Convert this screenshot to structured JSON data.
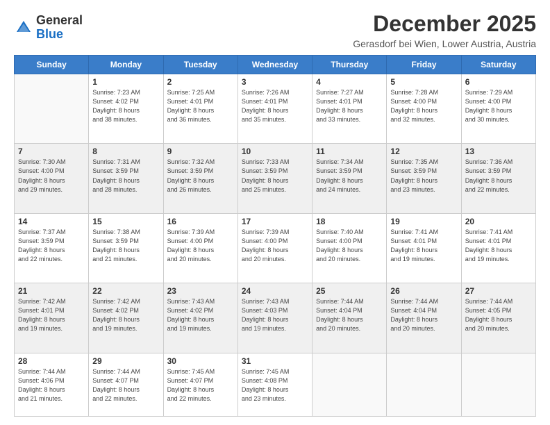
{
  "logo": {
    "general": "General",
    "blue": "Blue"
  },
  "title": "December 2025",
  "location": "Gerasdorf bei Wien, Lower Austria, Austria",
  "weekdays": [
    "Sunday",
    "Monday",
    "Tuesday",
    "Wednesday",
    "Thursday",
    "Friday",
    "Saturday"
  ],
  "weeks": [
    [
      {
        "day": "",
        "info": ""
      },
      {
        "day": "1",
        "info": "Sunrise: 7:23 AM\nSunset: 4:02 PM\nDaylight: 8 hours\nand 38 minutes."
      },
      {
        "day": "2",
        "info": "Sunrise: 7:25 AM\nSunset: 4:01 PM\nDaylight: 8 hours\nand 36 minutes."
      },
      {
        "day": "3",
        "info": "Sunrise: 7:26 AM\nSunset: 4:01 PM\nDaylight: 8 hours\nand 35 minutes."
      },
      {
        "day": "4",
        "info": "Sunrise: 7:27 AM\nSunset: 4:01 PM\nDaylight: 8 hours\nand 33 minutes."
      },
      {
        "day": "5",
        "info": "Sunrise: 7:28 AM\nSunset: 4:00 PM\nDaylight: 8 hours\nand 32 minutes."
      },
      {
        "day": "6",
        "info": "Sunrise: 7:29 AM\nSunset: 4:00 PM\nDaylight: 8 hours\nand 30 minutes."
      }
    ],
    [
      {
        "day": "7",
        "info": "Sunrise: 7:30 AM\nSunset: 4:00 PM\nDaylight: 8 hours\nand 29 minutes."
      },
      {
        "day": "8",
        "info": "Sunrise: 7:31 AM\nSunset: 3:59 PM\nDaylight: 8 hours\nand 28 minutes."
      },
      {
        "day": "9",
        "info": "Sunrise: 7:32 AM\nSunset: 3:59 PM\nDaylight: 8 hours\nand 26 minutes."
      },
      {
        "day": "10",
        "info": "Sunrise: 7:33 AM\nSunset: 3:59 PM\nDaylight: 8 hours\nand 25 minutes."
      },
      {
        "day": "11",
        "info": "Sunrise: 7:34 AM\nSunset: 3:59 PM\nDaylight: 8 hours\nand 24 minutes."
      },
      {
        "day": "12",
        "info": "Sunrise: 7:35 AM\nSunset: 3:59 PM\nDaylight: 8 hours\nand 23 minutes."
      },
      {
        "day": "13",
        "info": "Sunrise: 7:36 AM\nSunset: 3:59 PM\nDaylight: 8 hours\nand 22 minutes."
      }
    ],
    [
      {
        "day": "14",
        "info": "Sunrise: 7:37 AM\nSunset: 3:59 PM\nDaylight: 8 hours\nand 22 minutes."
      },
      {
        "day": "15",
        "info": "Sunrise: 7:38 AM\nSunset: 3:59 PM\nDaylight: 8 hours\nand 21 minutes."
      },
      {
        "day": "16",
        "info": "Sunrise: 7:39 AM\nSunset: 4:00 PM\nDaylight: 8 hours\nand 20 minutes."
      },
      {
        "day": "17",
        "info": "Sunrise: 7:39 AM\nSunset: 4:00 PM\nDaylight: 8 hours\nand 20 minutes."
      },
      {
        "day": "18",
        "info": "Sunrise: 7:40 AM\nSunset: 4:00 PM\nDaylight: 8 hours\nand 20 minutes."
      },
      {
        "day": "19",
        "info": "Sunrise: 7:41 AM\nSunset: 4:01 PM\nDaylight: 8 hours\nand 19 minutes."
      },
      {
        "day": "20",
        "info": "Sunrise: 7:41 AM\nSunset: 4:01 PM\nDaylight: 8 hours\nand 19 minutes."
      }
    ],
    [
      {
        "day": "21",
        "info": "Sunrise: 7:42 AM\nSunset: 4:01 PM\nDaylight: 8 hours\nand 19 minutes."
      },
      {
        "day": "22",
        "info": "Sunrise: 7:42 AM\nSunset: 4:02 PM\nDaylight: 8 hours\nand 19 minutes."
      },
      {
        "day": "23",
        "info": "Sunrise: 7:43 AM\nSunset: 4:02 PM\nDaylight: 8 hours\nand 19 minutes."
      },
      {
        "day": "24",
        "info": "Sunrise: 7:43 AM\nSunset: 4:03 PM\nDaylight: 8 hours\nand 19 minutes."
      },
      {
        "day": "25",
        "info": "Sunrise: 7:44 AM\nSunset: 4:04 PM\nDaylight: 8 hours\nand 20 minutes."
      },
      {
        "day": "26",
        "info": "Sunrise: 7:44 AM\nSunset: 4:04 PM\nDaylight: 8 hours\nand 20 minutes."
      },
      {
        "day": "27",
        "info": "Sunrise: 7:44 AM\nSunset: 4:05 PM\nDaylight: 8 hours\nand 20 minutes."
      }
    ],
    [
      {
        "day": "28",
        "info": "Sunrise: 7:44 AM\nSunset: 4:06 PM\nDaylight: 8 hours\nand 21 minutes."
      },
      {
        "day": "29",
        "info": "Sunrise: 7:44 AM\nSunset: 4:07 PM\nDaylight: 8 hours\nand 22 minutes."
      },
      {
        "day": "30",
        "info": "Sunrise: 7:45 AM\nSunset: 4:07 PM\nDaylight: 8 hours\nand 22 minutes."
      },
      {
        "day": "31",
        "info": "Sunrise: 7:45 AM\nSunset: 4:08 PM\nDaylight: 8 hours\nand 23 minutes."
      },
      {
        "day": "",
        "info": ""
      },
      {
        "day": "",
        "info": ""
      },
      {
        "day": "",
        "info": ""
      }
    ]
  ]
}
